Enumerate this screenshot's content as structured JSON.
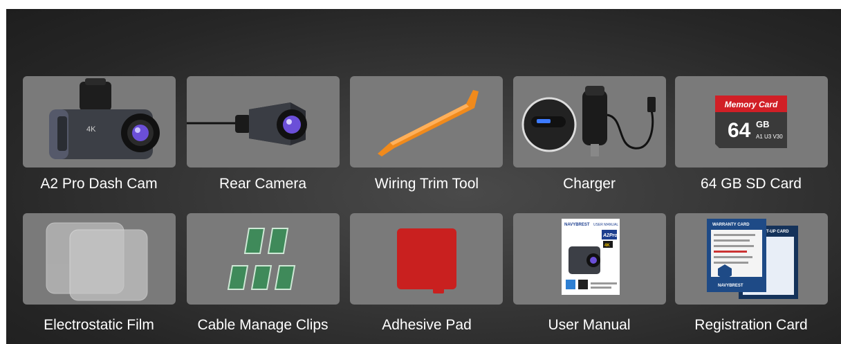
{
  "items": [
    {
      "label": "A2 Pro Dash Cam",
      "icon": "dash-cam-icon",
      "badge": "4K"
    },
    {
      "label": "Rear Camera",
      "icon": "rear-camera-icon"
    },
    {
      "label": "Wiring Trim Tool",
      "icon": "trim-tool-icon"
    },
    {
      "label": "Charger",
      "icon": "car-charger-icon"
    },
    {
      "label": "64 GB SD Card",
      "icon": "sd-card-icon",
      "card_title": "Memory Card",
      "card_capacity": "64",
      "card_unit": "GB",
      "card_specs": "A1 U3 V30"
    },
    {
      "label": "Electrostatic Film",
      "icon": "electrostatic-film-icon"
    },
    {
      "label": "Cable Manage Clips",
      "icon": "cable-clips-icon"
    },
    {
      "label": "Adhesive Pad",
      "icon": "adhesive-pad-icon"
    },
    {
      "label": "User Manual",
      "icon": "user-manual-icon",
      "brand": "NAVYBREST",
      "manual_title": "USER MANUAL",
      "model": "A2Pro",
      "badge": "4K"
    },
    {
      "label": "Registration Card",
      "icon": "registration-card-icon",
      "warranty_title": "WARRANTY CARD",
      "setup_title": "SET-UP CARD",
      "brand": "NAVYBREST"
    }
  ],
  "colors": {
    "panel": "#2b2b2b",
    "card": "#7a7a7a",
    "trim_tool": "#f08a1c",
    "sd_card_red": "#d11f26",
    "adhesive_red": "#c9201f",
    "clip_green": "#3f8a5a",
    "lens_purple": "#6b4fd8"
  }
}
